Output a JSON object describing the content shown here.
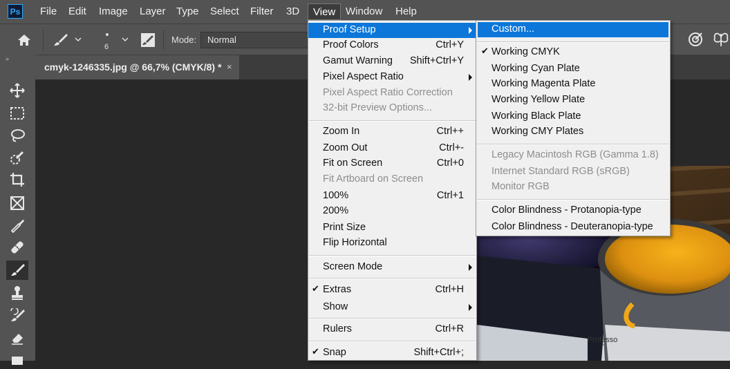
{
  "app": {
    "logo": "Ps"
  },
  "menubar": {
    "items": [
      "File",
      "Edit",
      "Image",
      "Layer",
      "Type",
      "Select",
      "Filter",
      "3D",
      "View",
      "Window",
      "Help"
    ],
    "active": "View"
  },
  "options": {
    "brush_size": "6",
    "mode_label": "Mode:",
    "mode_value": "Normal"
  },
  "document": {
    "tab_title": "cmyk-1246335.jpg @ 66,7% (CMYK/8) *",
    "close_glyph": "×"
  },
  "toolbar": {
    "grip": "»",
    "tools": [
      "move-tool",
      "marquee-tool",
      "lasso-tool",
      "quick-selection-tool",
      "crop-tool",
      "frame-tool",
      "eyedropper-tool",
      "healing-brush-tool",
      "brush-tool",
      "clone-stamp-tool",
      "history-brush-tool",
      "eraser-tool",
      "gradient-tool"
    ],
    "selected": "brush-tool"
  },
  "view_menu": {
    "items": [
      {
        "label": "Proof Setup",
        "shortcut": "",
        "submenu": true,
        "highlight": true
      },
      {
        "label": "Proof Colors",
        "shortcut": "Ctrl+Y"
      },
      {
        "label": "Gamut Warning",
        "shortcut": "Shift+Ctrl+Y"
      },
      {
        "label": "Pixel Aspect Ratio",
        "shortcut": "",
        "submenu": true
      },
      {
        "label": "Pixel Aspect Ratio Correction",
        "shortcut": "",
        "disabled": true
      },
      {
        "label": "32-bit Preview Options...",
        "shortcut": "",
        "disabled": true
      },
      {
        "label": "Zoom In",
        "shortcut": "Ctrl++"
      },
      {
        "label": "Zoom Out",
        "shortcut": "Ctrl+-"
      },
      {
        "label": "Fit on Screen",
        "shortcut": "Ctrl+0"
      },
      {
        "label": "Fit Artboard on Screen",
        "shortcut": "",
        "disabled": true
      },
      {
        "label": "100%",
        "shortcut": "Ctrl+1"
      },
      {
        "label": "200%",
        "shortcut": ""
      },
      {
        "label": "Print Size",
        "shortcut": ""
      },
      {
        "label": "Flip Horizontal",
        "shortcut": ""
      },
      {
        "label": "Screen Mode",
        "shortcut": "",
        "submenu": true
      },
      {
        "label": "Extras",
        "shortcut": "Ctrl+H",
        "checked": true
      },
      {
        "label": "Show",
        "shortcut": "",
        "submenu": true
      },
      {
        "label": "Rulers",
        "shortcut": "Ctrl+R"
      },
      {
        "label": "Snap",
        "shortcut": "Shift+Ctrl+;",
        "checked": true
      }
    ]
  },
  "proof_setup_submenu": {
    "items": [
      {
        "label": "Custom...",
        "highlight": true
      },
      {
        "label": "Working CMYK",
        "checked": true
      },
      {
        "label": "Working Cyan Plate"
      },
      {
        "label": "Working Magenta Plate"
      },
      {
        "label": "Working Yellow Plate"
      },
      {
        "label": "Working Black Plate"
      },
      {
        "label": "Working CMY Plates"
      },
      {
        "label": "Legacy Macintosh RGB (Gamma 1.8)",
        "disabled": true
      },
      {
        "label": "Internet Standard RGB (sRGB)",
        "disabled": true
      },
      {
        "label": "Monitor RGB",
        "disabled": true
      },
      {
        "label": "Color Blindness - Protanopia-type"
      },
      {
        "label": "Color Blindness - Deuteranopia-type"
      }
    ]
  },
  "photo": {
    "label_text": "Professo"
  },
  "colors": {
    "highlight": "#0c77d9",
    "menu_bg": "#f0f0f0",
    "chrome": "#535353",
    "canvas": "#282828"
  }
}
